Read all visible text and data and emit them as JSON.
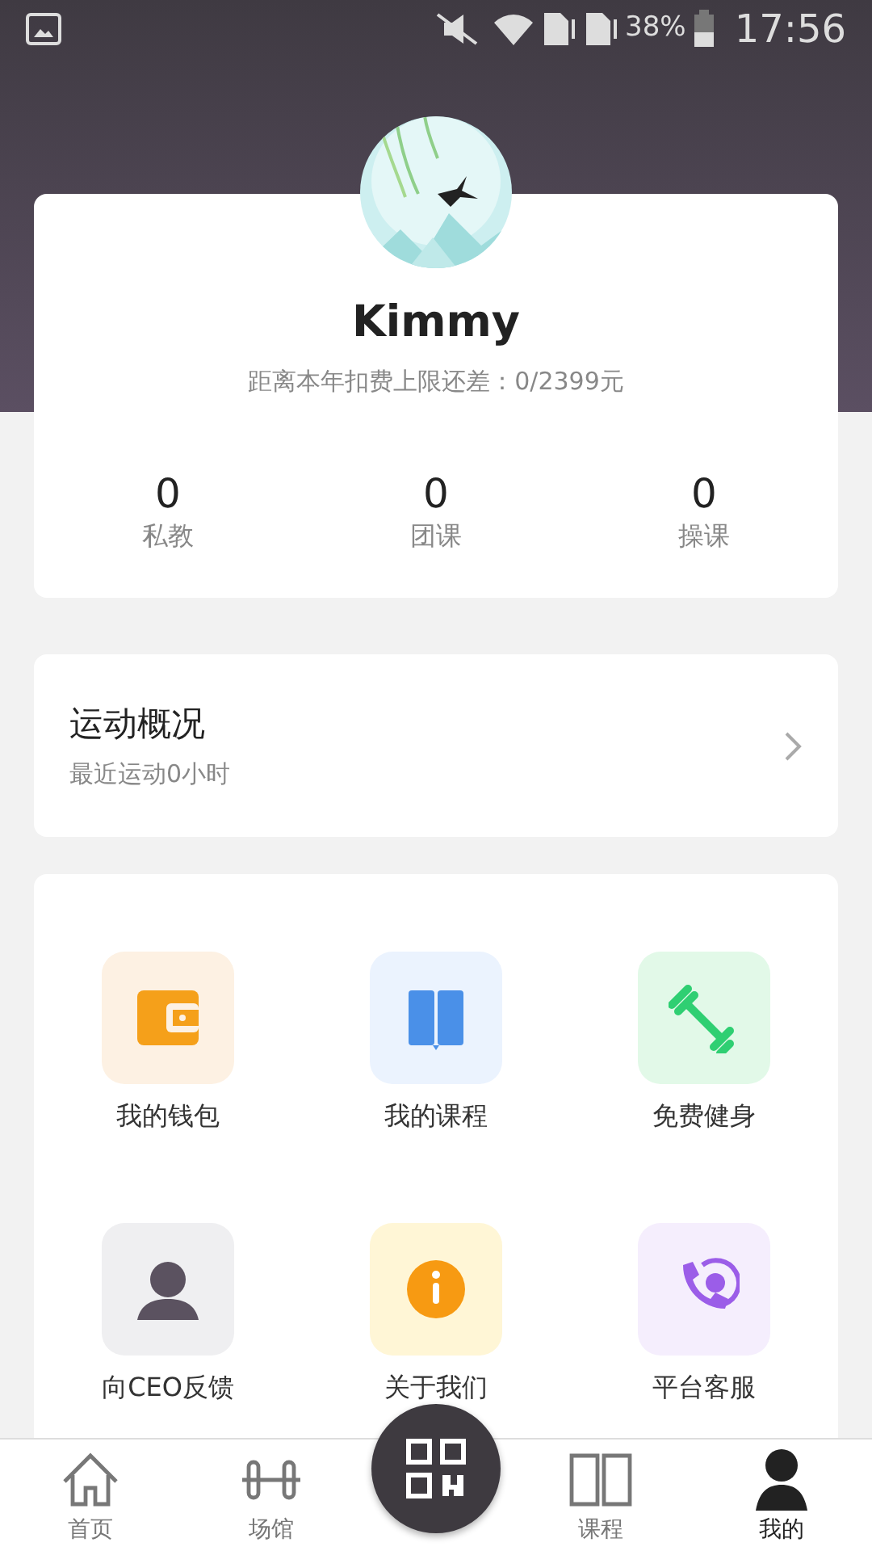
{
  "status_bar": {
    "battery": "38%",
    "time": "17:56"
  },
  "profile": {
    "name": "Kimmy",
    "subtitle": "距离本年扣费上限还差：0/2399元",
    "stats": [
      {
        "value": "0",
        "label": "私教"
      },
      {
        "value": "0",
        "label": "团课"
      },
      {
        "value": "0",
        "label": "操课"
      }
    ]
  },
  "exercise": {
    "title": "运动概况",
    "subtitle": "最近运动0小时"
  },
  "menu": [
    {
      "kind": "wallet",
      "label": "我的钱包"
    },
    {
      "kind": "book",
      "label": "我的课程"
    },
    {
      "kind": "dumbbell",
      "label": "免费健身"
    },
    {
      "kind": "person",
      "label": "向CEO反馈"
    },
    {
      "kind": "info",
      "label": "关于我们"
    },
    {
      "kind": "phone",
      "label": "平台客服"
    }
  ],
  "tab_bar": [
    {
      "kind": "home",
      "label": "首页",
      "selected": false
    },
    {
      "kind": "gym",
      "label": "场馆",
      "selected": false
    },
    {
      "kind": "scan",
      "selected": false
    },
    {
      "kind": "book",
      "label": "课程",
      "selected": false
    },
    {
      "kind": "me",
      "label": "我的",
      "selected": true
    }
  ]
}
